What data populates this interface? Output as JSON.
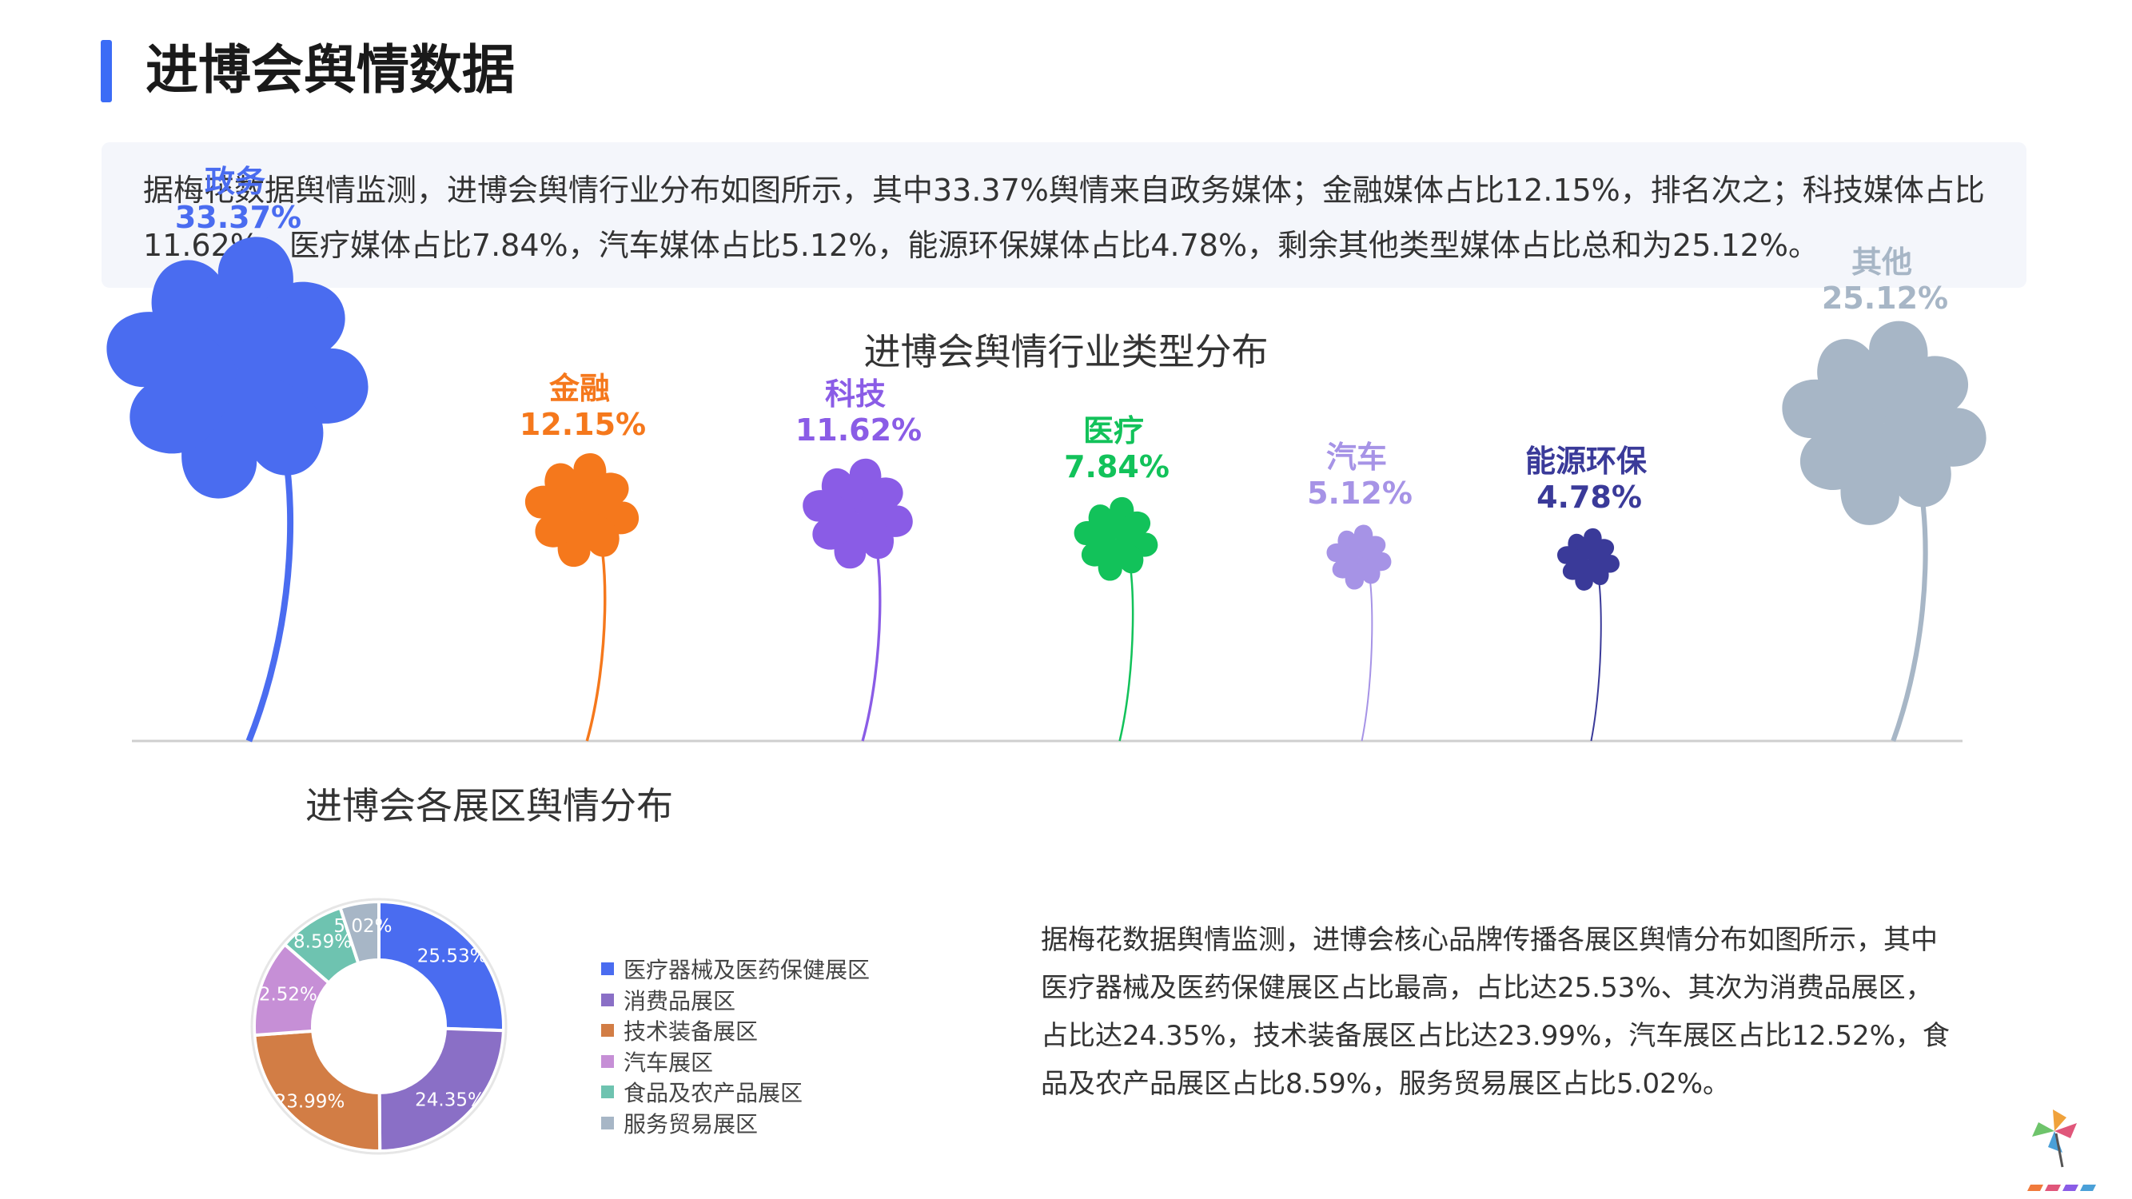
{
  "page": {
    "title": "进博会舆情数据",
    "summary": "据梅花数据舆情监测，进博会舆情行业分布如图所示，其中33.37%舆情来自政务媒体；金融媒体占比12.15%，排名次之；科技媒体占比11.62%，医疗媒体占比7.84%，汽车媒体占比5.12%，能源环保媒体占比4.78%，剩余其他类型媒体占比总和为25.12%。",
    "body_text": "据梅花数据舆情监测，进博会核心品牌传播各展区舆情分布如图所示，其中医疗器械及医药保健展区占比最高，占比达25.53%、其次为消费品展区，占比达24.35%，技术装备展区占比达23.99%，汽车展区占比12.52%，食品及农产品展区占比8.59%，服务贸易展区占比5.02%。"
  },
  "chart_data": [
    {
      "type": "pictorial-bar",
      "title": "进博会舆情行业类型分布",
      "unit": "%",
      "categories": [
        "政务",
        "金融",
        "科技",
        "医疗",
        "汽车",
        "能源环保",
        "其他"
      ],
      "values": [
        33.37,
        12.15,
        11.62,
        7.84,
        5.12,
        4.78,
        25.12
      ],
      "labels": [
        "33.37%",
        "12.15%",
        "11.62%",
        "7.84%",
        "5.12%",
        "4.78%",
        "25.12%"
      ],
      "colors": [
        "#4a6cf0",
        "#f5781c",
        "#8a5ce6",
        "#12c25a",
        "#a693e6",
        "#3a3a99",
        "#a7b6c6"
      ],
      "icon": "four-leaf-clover-icon"
    },
    {
      "type": "donut",
      "title": "进博会各展区舆情分布",
      "categories": [
        "医疗器械及医药保健展区",
        "消费品展区",
        "技术装备展区",
        "汽车展区",
        "食品及农产品展区",
        "服务贸易展区"
      ],
      "values": [
        25.53,
        24.35,
        23.99,
        12.52,
        8.59,
        5.02
      ],
      "labels": [
        "25.53%",
        "24.35%",
        "23.99%",
        "12.52%",
        "8.59%",
        "5.02%"
      ],
      "colors": [
        "#4a6cf0",
        "#8a6fc6",
        "#d27d45",
        "#c68fd6",
        "#6ec3b0",
        "#a7b6c6"
      ],
      "legend": "right"
    }
  ]
}
